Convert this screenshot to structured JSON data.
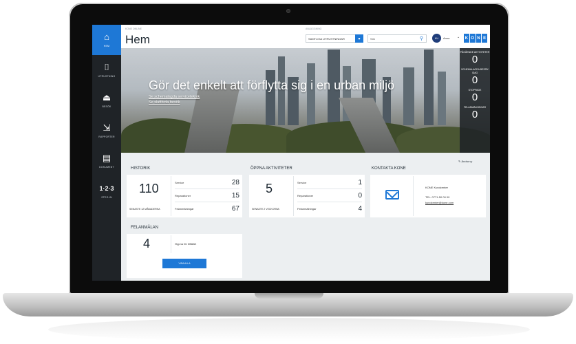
{
  "nav": [
    {
      "icon": "⌂",
      "label": "Hem"
    },
    {
      "icon": "⌷",
      "label": "Utrustning"
    },
    {
      "icon": "⏏",
      "label": "Besök"
    },
    {
      "icon": "⇲",
      "label": "Rapporter"
    },
    {
      "icon": "▤",
      "label": "Dokument"
    },
    {
      "icon": "1·2·3",
      "label": "Steg-in"
    }
  ],
  "header": {
    "crumb": "KONE Online",
    "title": "Hem",
    "site_label": "Anläggning",
    "site_value": "SAMTLIGA UTRUSTNINGAR",
    "search_placeholder": "Sök",
    "avatar": "KU",
    "username": "Anna",
    "logo": [
      "K",
      "O",
      "N",
      "E"
    ]
  },
  "hero": {
    "title": "Gör det enkelt att förflytta sig i en urban miljö",
    "links": [
      "Se schemalagda serviceteknik",
      "Se slutförda besök"
    ]
  },
  "status": [
    {
      "label": "Pågående aktiviteter",
      "value": "0"
    },
    {
      "label": "Schemalagda besök idag",
      "value": "0"
    },
    {
      "label": "Stoppade",
      "value": "0"
    },
    {
      "label": "Felanmälningar",
      "value": "0"
    }
  ],
  "historik": {
    "title": "Historik",
    "total": "110",
    "foot": "Senaste 12 månaderna",
    "rows": [
      {
        "label": "Service",
        "value": "28"
      },
      {
        "label": "Reparationer",
        "value": "15"
      },
      {
        "label": "Felanmälningar",
        "value": "67"
      }
    ]
  },
  "open": {
    "title": "Öppna aktiviteter",
    "total": "5",
    "foot": "Senaste 2 veckorna",
    "rows": [
      {
        "label": "Service",
        "value": "1"
      },
      {
        "label": "Reparationer",
        "value": "0"
      },
      {
        "label": "Felanmälningar",
        "value": "4"
      }
    ]
  },
  "contact": {
    "title": "Kontakta KONE",
    "edit": "Ändra vy",
    "lines": [
      "KONE Kundcenter",
      "TEL: 0771-50 00 00",
      "kundcenter@kone.com"
    ]
  },
  "felanmalan": {
    "title": "Felanmälan",
    "total": "4",
    "label": "Öppna för tillfället",
    "button": "Visa alla"
  }
}
